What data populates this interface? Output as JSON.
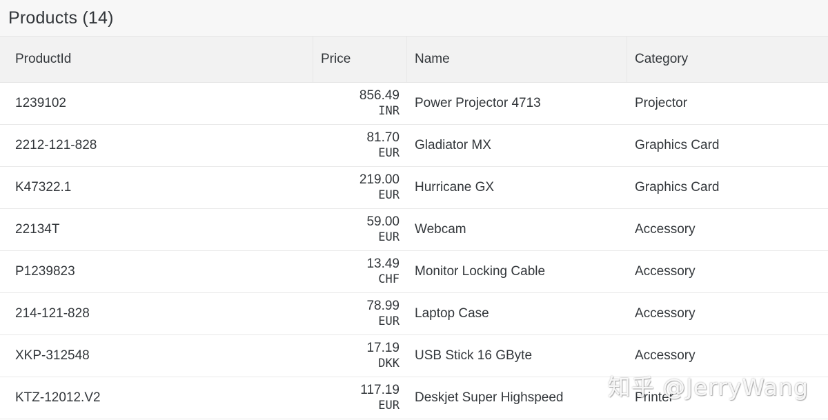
{
  "toolbar": {
    "title": "Products (14)"
  },
  "table": {
    "columns": {
      "product_id": "ProductId",
      "price": "Price",
      "name": "Name",
      "category": "Category"
    },
    "rows": [
      {
        "product_id": "1239102",
        "amount": "856.49",
        "currency": "INR",
        "name": "Power Projector 4713",
        "category": "Projector"
      },
      {
        "product_id": "2212-121-828",
        "amount": "81.70",
        "currency": "EUR",
        "name": "Gladiator MX",
        "category": "Graphics Card"
      },
      {
        "product_id": "K47322.1",
        "amount": "219.00",
        "currency": "EUR",
        "name": "Hurricane GX",
        "category": "Graphics Card"
      },
      {
        "product_id": "22134T",
        "amount": "59.00",
        "currency": "EUR",
        "name": "Webcam",
        "category": "Accessory"
      },
      {
        "product_id": "P1239823",
        "amount": "13.49",
        "currency": "CHF",
        "name": "Monitor Locking Cable",
        "category": "Accessory"
      },
      {
        "product_id": "214-121-828",
        "amount": "78.99",
        "currency": "EUR",
        "name": "Laptop Case",
        "category": "Accessory"
      },
      {
        "product_id": "XKP-312548",
        "amount": "17.19",
        "currency": "DKK",
        "name": "USB Stick 16 GByte",
        "category": "Accessory"
      },
      {
        "product_id": "KTZ-12012.V2",
        "amount": "117.19",
        "currency": "EUR",
        "name": "Deskjet Super Highspeed",
        "category": "Printer"
      }
    ]
  },
  "watermark": "知乎 @JerryWang"
}
